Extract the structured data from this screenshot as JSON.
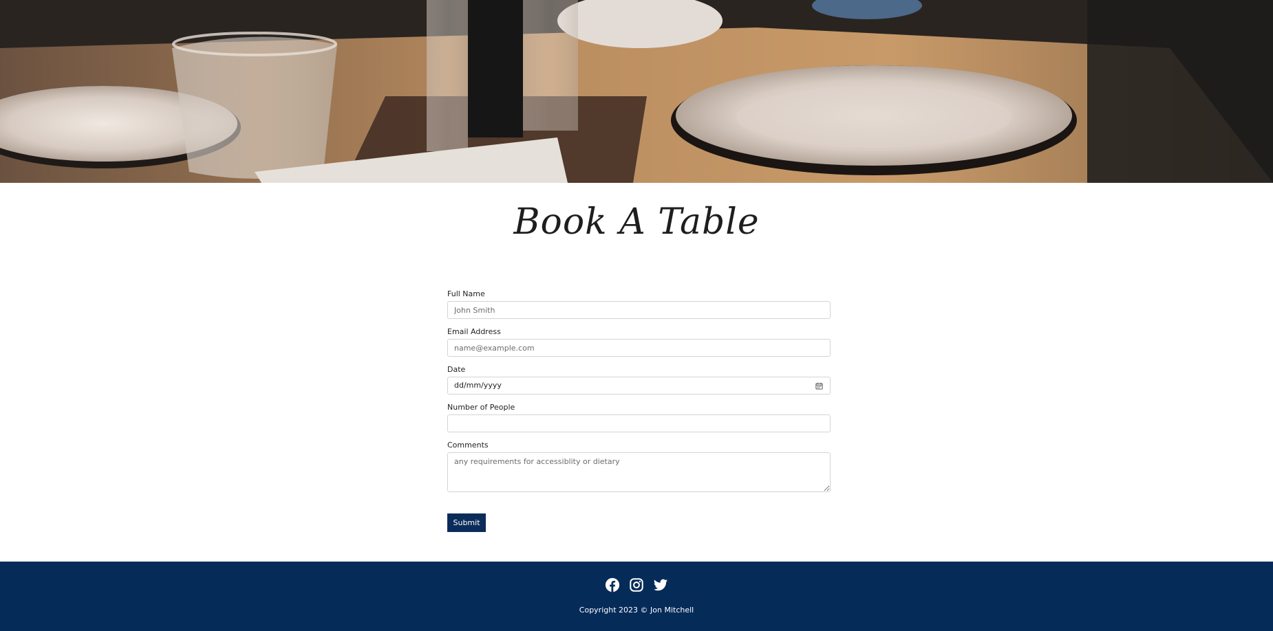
{
  "hero": {
    "image_alt": "restaurant table set with plates and glasses"
  },
  "page": {
    "title": "Book A Table"
  },
  "form": {
    "full_name": {
      "label": "Full Name",
      "placeholder": "John Smith",
      "value": ""
    },
    "email": {
      "label": "Email Address",
      "placeholder": "name@example.com",
      "value": ""
    },
    "date": {
      "label": "Date",
      "value": "dd/mm/yyyy",
      "icon": "calendar-icon"
    },
    "people": {
      "label": "Number of People",
      "value": ""
    },
    "comments": {
      "label": "Comments",
      "placeholder": "any requirements for accessiblity or dietary",
      "value": ""
    },
    "submit_label": "Submit"
  },
  "footer": {
    "social": [
      {
        "name": "facebook",
        "icon": "facebook-icon"
      },
      {
        "name": "instagram",
        "icon": "instagram-icon"
      },
      {
        "name": "twitter",
        "icon": "twitter-icon"
      }
    ],
    "copyright": "Copyright 2023 © Jon Mitchell"
  },
  "colors": {
    "primary": "#052b59",
    "button": "#0b2c5a",
    "text": "#222222",
    "input_border": "#cfd4da",
    "background": "#ffffff"
  }
}
